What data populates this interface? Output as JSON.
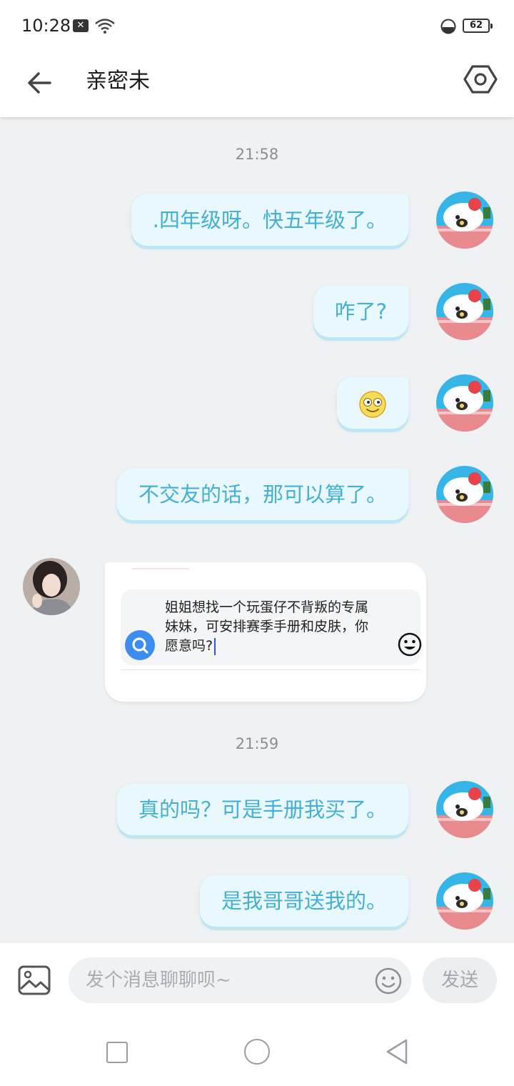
{
  "status_bar": {
    "time": "10:28",
    "notification_glyph": "✕",
    "battery": "62"
  },
  "header": {
    "title": "亲密未",
    "back_icon": "arrow-left-icon",
    "settings_icon": "hexagon-settings-icon"
  },
  "chat": {
    "timestamps": [
      "21:58",
      "21:59"
    ],
    "messages": [
      {
        "direction": "out",
        "text": ".四年级呀。快五年级了。"
      },
      {
        "direction": "out",
        "text": "咋了?"
      },
      {
        "direction": "out",
        "emoji": "smiling-face-emoji"
      },
      {
        "direction": "out",
        "text": "不交友的话，那可以算了。"
      },
      {
        "direction": "in",
        "image_text": "姐姐想找一个玩蛋仔不背叛的专属妹妹，可安排赛季手册和皮肤，你愿意吗?"
      },
      {
        "direction": "out",
        "text": "真的吗？可是手册我买了。"
      },
      {
        "direction": "out",
        "text": "是我哥哥送我的。"
      }
    ]
  },
  "input_bar": {
    "placeholder": "发个消息聊聊呗~",
    "value": "",
    "send_label": "发送"
  },
  "colors": {
    "bubble_text": "#45b0d3",
    "bubble_bg": "#e8f8fd",
    "chat_bg": "#f0f1f3"
  }
}
